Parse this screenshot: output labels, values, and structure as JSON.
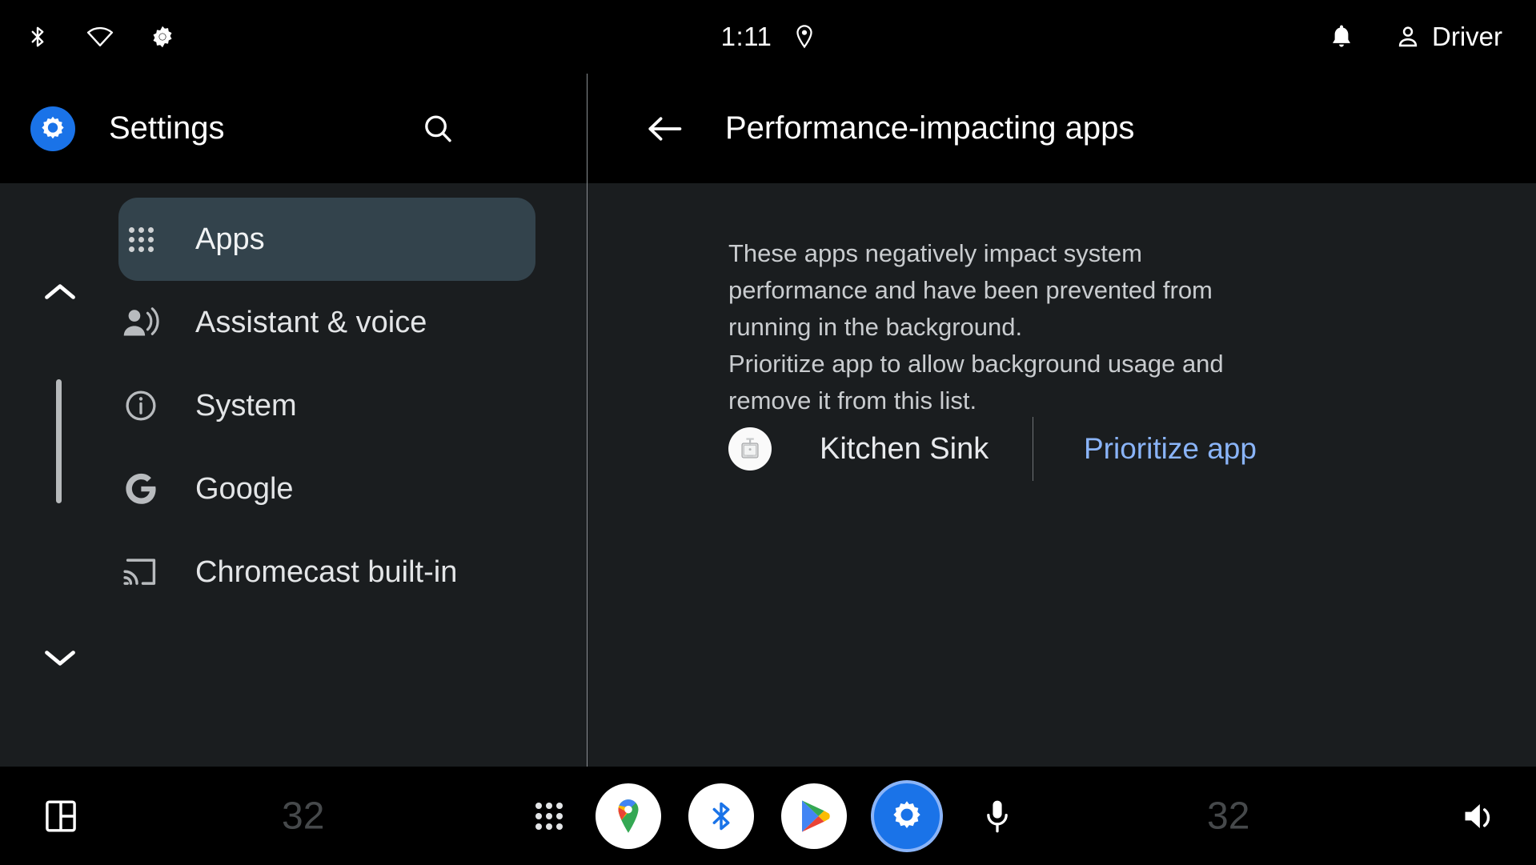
{
  "statusbar": {
    "time": "1:11",
    "user_label": "Driver",
    "icons": {
      "bluetooth": "bluetooth-icon",
      "wifi": "wifi-icon",
      "brightness": "brightness-icon",
      "location": "location-pin-icon",
      "notification": "notification-bell-icon",
      "user": "person-icon"
    }
  },
  "sidebar": {
    "title": "Settings",
    "logo_icon": "settings-gear-icon",
    "search_icon": "search-icon",
    "scroll_up_icon": "chevron-up-icon",
    "scroll_down_icon": "chevron-down-icon",
    "items": [
      {
        "label": "Apps",
        "icon": "apps-grid-icon",
        "selected": true
      },
      {
        "label": "Assistant & voice",
        "icon": "assistant-voice-icon",
        "selected": false
      },
      {
        "label": "System",
        "icon": "info-circle-icon",
        "selected": false
      },
      {
        "label": "Google",
        "icon": "google-g-icon",
        "selected": false
      },
      {
        "label": "Chromecast built-in",
        "icon": "cast-icon",
        "selected": false
      }
    ]
  },
  "detail": {
    "back_icon": "back-arrow-icon",
    "title": "Performance-impacting apps",
    "description_lines": [
      "These apps negatively impact system",
      "performance and have been prevented from",
      "running in the background.",
      "Prioritize app to allow background usage and",
      "remove it from this list."
    ],
    "apps": [
      {
        "name": "Kitchen Sink",
        "icon": "kitchen-sink-app-icon",
        "action_label": "Prioritize app"
      }
    ],
    "accent_color": "#8ab4f8"
  },
  "taskbar": {
    "layout_icon": "split-screen-icon",
    "temperature_left": "32",
    "temperature_right": "32",
    "grid_icon": "app-grid-icon",
    "mic_icon": "microphone-icon",
    "volume_icon": "volume-icon",
    "apps": [
      {
        "name": "maps",
        "icon": "google-maps-icon"
      },
      {
        "name": "bluetooth",
        "icon": "bluetooth-app-icon"
      },
      {
        "name": "play-store",
        "icon": "play-store-icon"
      },
      {
        "name": "settings",
        "icon": "settings-gear-app-icon",
        "active": true
      }
    ]
  },
  "colors": {
    "accent_blue": "#1a73e8",
    "link_blue": "#8ab4f8",
    "selected_item": "#33434c",
    "panel_bg": "#1a1d1f",
    "bar_bg": "#000000"
  }
}
